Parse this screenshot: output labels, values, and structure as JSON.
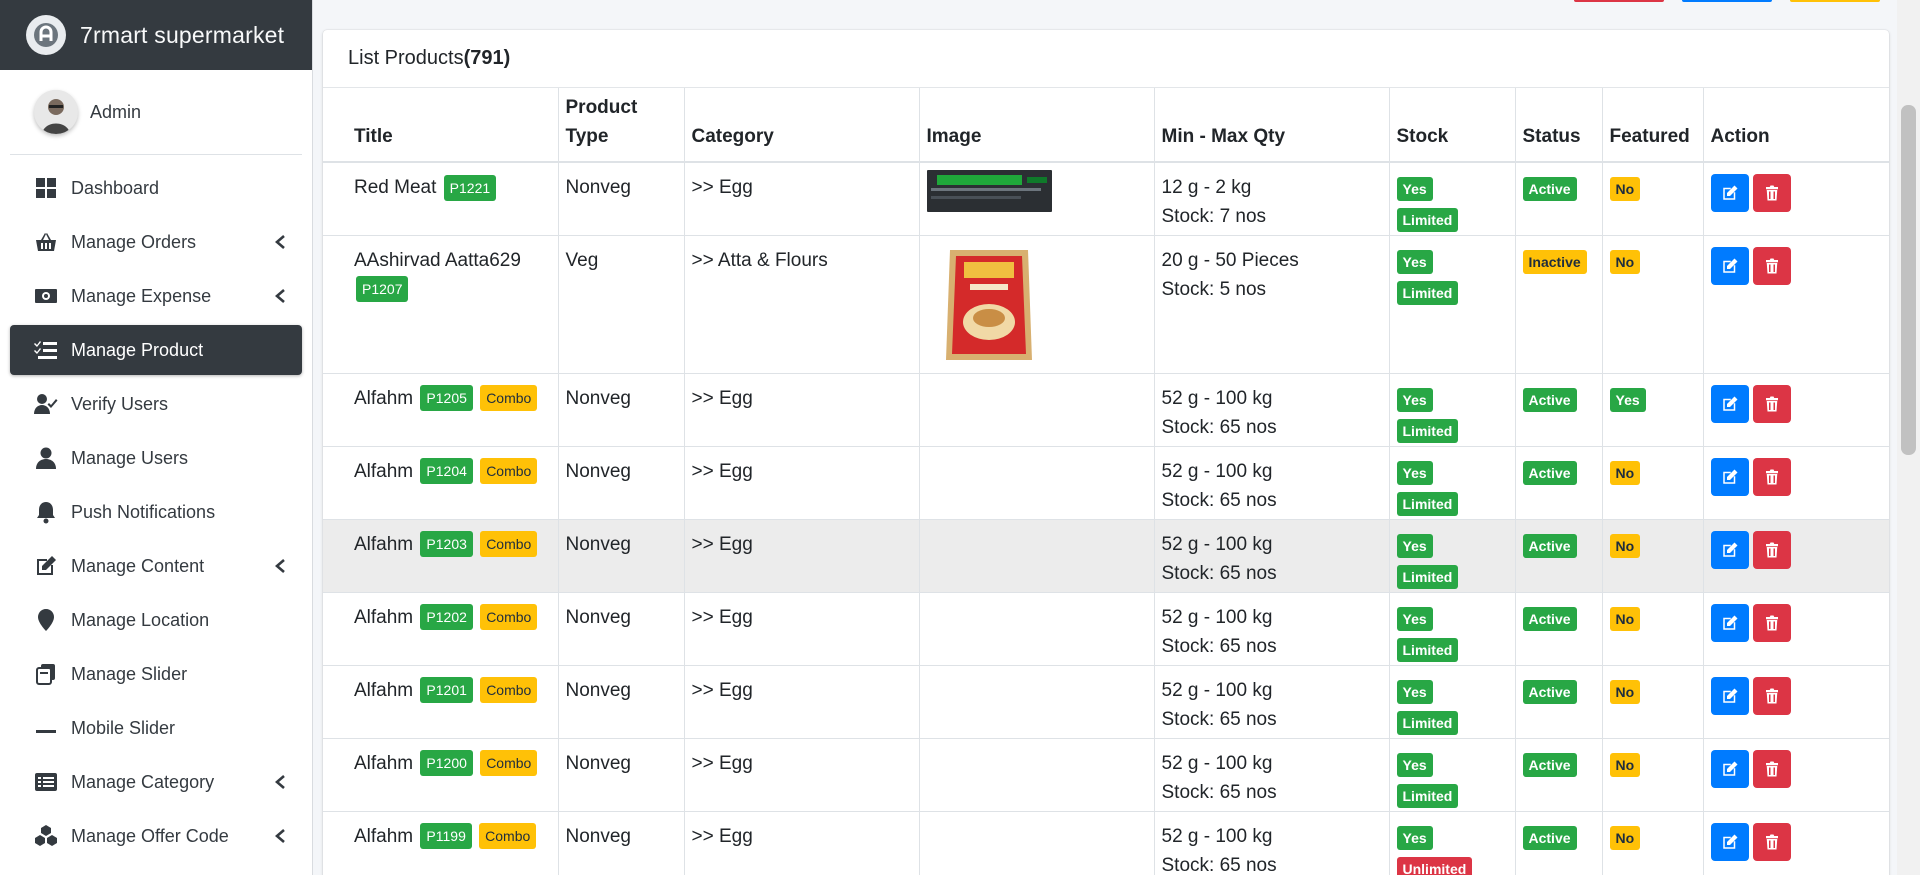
{
  "brand": {
    "title": "7rmart supermarket"
  },
  "user": {
    "name": "Admin"
  },
  "sidebar": {
    "items": [
      {
        "label": "Dashboard",
        "icon": "dashboard-icon",
        "chevron": false
      },
      {
        "label": "Manage Orders",
        "icon": "basket-icon",
        "chevron": true
      },
      {
        "label": "Manage Expense",
        "icon": "money-bill-icon",
        "chevron": true
      },
      {
        "label": "Manage Product",
        "icon": "list-check-icon",
        "chevron": false,
        "active": true
      },
      {
        "label": "Verify Users",
        "icon": "user-check-icon",
        "chevron": false
      },
      {
        "label": "Manage Users",
        "icon": "user-icon",
        "chevron": false
      },
      {
        "label": "Push Notifications",
        "icon": "bell-icon",
        "chevron": false
      },
      {
        "label": "Manage Content",
        "icon": "edit-icon",
        "chevron": true
      },
      {
        "label": "Manage Location",
        "icon": "map-marker-icon",
        "chevron": false
      },
      {
        "label": "Manage Slider",
        "icon": "slider-icon",
        "chevron": false
      },
      {
        "label": "Mobile Slider",
        "icon": "minus-icon",
        "chevron": false
      },
      {
        "label": "Manage Category",
        "icon": "list-alt-icon",
        "chevron": true
      },
      {
        "label": "Manage Offer Code",
        "icon": "cubes-icon",
        "chevron": true
      }
    ]
  },
  "card": {
    "title": "List Products",
    "count": "(791)"
  },
  "table": {
    "headers": [
      "Title",
      "Product Type",
      "Category",
      "Image",
      "Min - Max Qty",
      "Stock",
      "Status",
      "Featured",
      "Action"
    ],
    "rows": [
      {
        "title": "Red Meat",
        "code": "P1221",
        "combo": "",
        "type": "Nonveg",
        "category": ">> Egg",
        "image": "screenshot-thumbnail",
        "qty": "12 g - 2 kg",
        "stock_text": "Stock: 7 nos",
        "stock": "Yes",
        "limit": "Limited",
        "status": "Active",
        "featured": "No"
      },
      {
        "title": "AAshirvad Aatta629",
        "code": "P1207",
        "combo": "",
        "type": "Veg",
        "category": ">> Atta & Flours",
        "image": "flour-bag-thumbnail",
        "qty": "20 g - 50 Pieces",
        "stock_text": "Stock: 5 nos",
        "stock": "Yes",
        "limit": "Limited",
        "status": "Inactive",
        "featured": "No"
      },
      {
        "title": "Alfahm",
        "code": "P1205",
        "combo": "Combo",
        "type": "Nonveg",
        "category": ">> Egg",
        "image": "",
        "qty": "52 g - 100 kg",
        "stock_text": "Stock: 65 nos",
        "stock": "Yes",
        "limit": "Limited",
        "status": "Active",
        "featured": "Yes"
      },
      {
        "title": "Alfahm",
        "code": "P1204",
        "combo": "Combo",
        "type": "Nonveg",
        "category": ">> Egg",
        "image": "",
        "qty": "52 g - 100 kg",
        "stock_text": "Stock: 65 nos",
        "stock": "Yes",
        "limit": "Limited",
        "status": "Active",
        "featured": "No"
      },
      {
        "title": "Alfahm",
        "code": "P1203",
        "combo": "Combo",
        "type": "Nonveg",
        "category": ">> Egg",
        "image": "",
        "qty": "52 g - 100 kg",
        "stock_text": "Stock: 65 nos",
        "stock": "Yes",
        "limit": "Limited",
        "status": "Active",
        "featured": "No"
      },
      {
        "title": "Alfahm",
        "code": "P1202",
        "combo": "Combo",
        "type": "Nonveg",
        "category": ">> Egg",
        "image": "",
        "qty": "52 g - 100 kg",
        "stock_text": "Stock: 65 nos",
        "stock": "Yes",
        "limit": "Limited",
        "status": "Active",
        "featured": "No"
      },
      {
        "title": "Alfahm",
        "code": "P1201",
        "combo": "Combo",
        "type": "Nonveg",
        "category": ">> Egg",
        "image": "",
        "qty": "52 g - 100 kg",
        "stock_text": "Stock: 65 nos",
        "stock": "Yes",
        "limit": "Limited",
        "status": "Active",
        "featured": "No"
      },
      {
        "title": "Alfahm",
        "code": "P1200",
        "combo": "Combo",
        "type": "Nonveg",
        "category": ">> Egg",
        "image": "",
        "qty": "52 g - 100 kg",
        "stock_text": "Stock: 65 nos",
        "stock": "Yes",
        "limit": "Limited",
        "status": "Active",
        "featured": "No"
      },
      {
        "title": "Alfahm",
        "code": "P1199",
        "combo": "Combo",
        "type": "Nonveg",
        "category": ">> Egg",
        "image": "",
        "qty": "52 g - 100 kg",
        "stock_text": "Stock: 65 nos",
        "stock": "Yes",
        "limit": "Unlimited",
        "status": "Active",
        "featured": "No"
      }
    ]
  },
  "colors": {
    "green": "#28a745",
    "yellow": "#ffc107",
    "red": "#dc3545",
    "blue": "#007bff",
    "dark": "#343a40"
  }
}
